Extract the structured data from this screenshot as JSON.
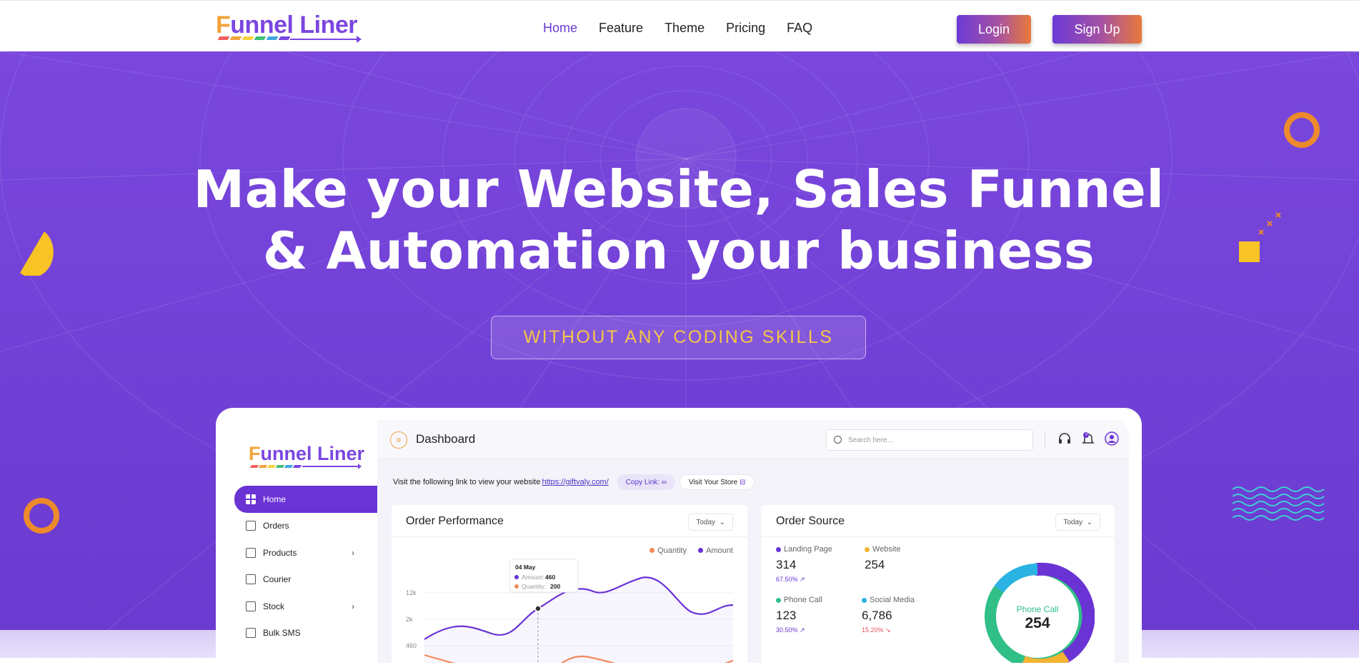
{
  "brand": {
    "logo_text_first": "F",
    "logo_text_rest": "unnel Liner",
    "logo_bar_colors": [
      "#f25c5c",
      "#f2a33a",
      "#f7d13a",
      "#3fbf73",
      "#3fa7e0",
      "#7b46e0"
    ]
  },
  "nav": {
    "links": [
      {
        "label": "Home",
        "active": true
      },
      {
        "label": "Feature",
        "active": false
      },
      {
        "label": "Theme",
        "active": false
      },
      {
        "label": "Pricing",
        "active": false
      },
      {
        "label": "FAQ",
        "active": false
      }
    ],
    "login_label": "Login",
    "signup_label": "Sign Up"
  },
  "hero": {
    "title_line1": "Make your Website, Sales Funnel",
    "title_line2": "& Automation your business",
    "badge": "WITHOUT ANY CODING SKILLS"
  },
  "dashboard": {
    "page_title": "Dashboard",
    "search_placeholder": "Search here...",
    "notification_count": "2",
    "sidebar": [
      {
        "label": "Home",
        "active": true,
        "icon": "grid-icon",
        "has_chevron": false
      },
      {
        "label": "Orders",
        "active": false,
        "icon": "clipboard-icon",
        "has_chevron": false
      },
      {
        "label": "Products",
        "active": false,
        "icon": "box-icon",
        "has_chevron": true
      },
      {
        "label": "Courier",
        "active": false,
        "icon": "truck-icon",
        "has_chevron": false
      },
      {
        "label": "Stock",
        "active": false,
        "icon": "warehouse-icon",
        "has_chevron": true
      },
      {
        "label": "Bulk SMS",
        "active": false,
        "icon": "message-icon",
        "has_chevron": false
      }
    ],
    "link_bar": {
      "text": "Visit the following link to view your website",
      "url": "https://giftvaly.com/",
      "copy_label": "Copy Link:",
      "visit_label": "Visit Your Store"
    },
    "order_performance": {
      "title": "Order Performance",
      "filter": "Today",
      "legend": [
        "Quantity",
        "Amount"
      ],
      "tooltip": {
        "date": "04 May",
        "amount_label": "Amount:",
        "amount_value": "460",
        "quantity_label": "Quantity:",
        "quantity_value": "200"
      },
      "y_ticks": [
        "12k",
        "2k",
        "460"
      ]
    },
    "order_source": {
      "title": "Order Source",
      "filter": "Today",
      "items": [
        {
          "label": "Landing Page",
          "value": "314",
          "pct": "67.50%",
          "trend": "up",
          "color": "#6a33d4"
        },
        {
          "label": "Website",
          "value": "254",
          "pct": "",
          "trend": "",
          "color": "#f2b431"
        },
        {
          "label": "Phone Call",
          "value": "123",
          "pct": "30.50%",
          "trend": "up",
          "color": "#2fbf87"
        },
        {
          "label": "Social Media",
          "value": "6,786",
          "pct": "15.20%",
          "trend": "down",
          "color": "#2ab3e3"
        }
      ],
      "donut_label": "Phone Call",
      "donut_value": "254"
    }
  },
  "colors": {
    "hero_bg": "#7444d9",
    "accent": "#6a33d4",
    "badge_text": "#f5c54a",
    "deco_orange": "#ec8a2c",
    "deco_yellow": "#f7c325",
    "deco_teal": "#3ed1d1"
  }
}
